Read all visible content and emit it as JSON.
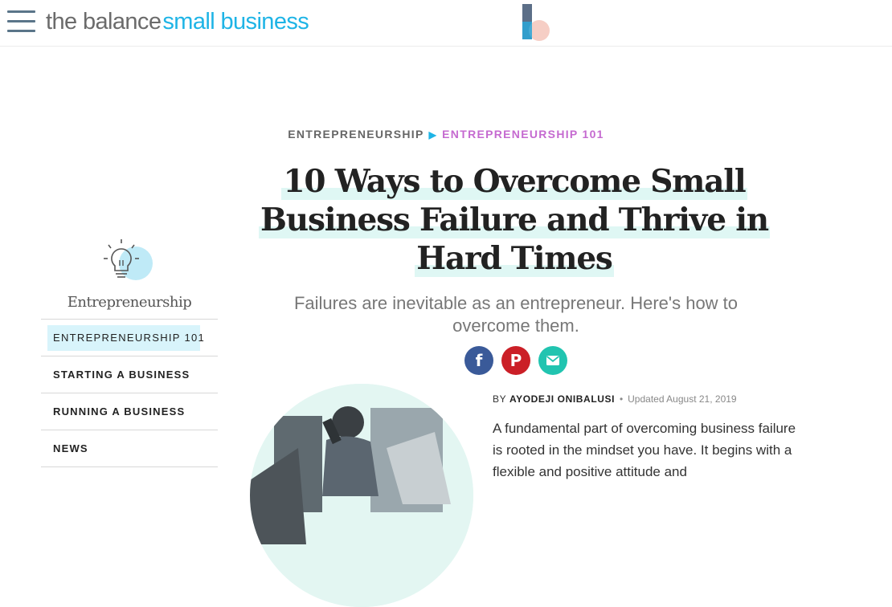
{
  "header": {
    "logo_part1": "the balance",
    "logo_part2": "small business",
    "menu_icon": "hamburger-menu-icon",
    "brand_mark_icon": "balance-b-logo-icon"
  },
  "breadcrumb": {
    "level1": "ENTREPRENEURSHIP",
    "separator": "▶",
    "level2": "ENTREPRENEURSHIP 101"
  },
  "article": {
    "title_lines": [
      "10 Ways to Overcome Small",
      "Business Failure and Thrive in",
      "Hard Times"
    ],
    "subtitle": "Failures are inevitable as an entrepreneur. Here's how to overcome them.",
    "byline_prefix": "BY",
    "author": "AYODEJI ONIBALUSI",
    "bullet": "•",
    "updated": "Updated August 21, 2019",
    "body": "A fundamental part of overcoming business failure is rooted in the mindset you have. It begins with a flexible and positive attitude and"
  },
  "share": {
    "facebook": "f",
    "pinterest": "P",
    "email_icon": "envelope-icon",
    "colors": {
      "facebook": "#3a5a99",
      "pinterest": "#cb1f27",
      "email": "#21c4b0"
    }
  },
  "sidebar": {
    "icon": "lightbulb-icon",
    "title": "Entrepreneurship",
    "items": [
      {
        "label": "ENTREPRENEURSHIP 101",
        "active": true
      },
      {
        "label": "STARTING A BUSINESS",
        "active": false
      },
      {
        "label": "RUNNING A BUSINESS",
        "active": false
      },
      {
        "label": "NEWS",
        "active": false
      }
    ]
  },
  "colors": {
    "accent": "#1eb4e6",
    "breadcrumb_active": "#c56ad0",
    "highlight": "#dff7f4"
  }
}
